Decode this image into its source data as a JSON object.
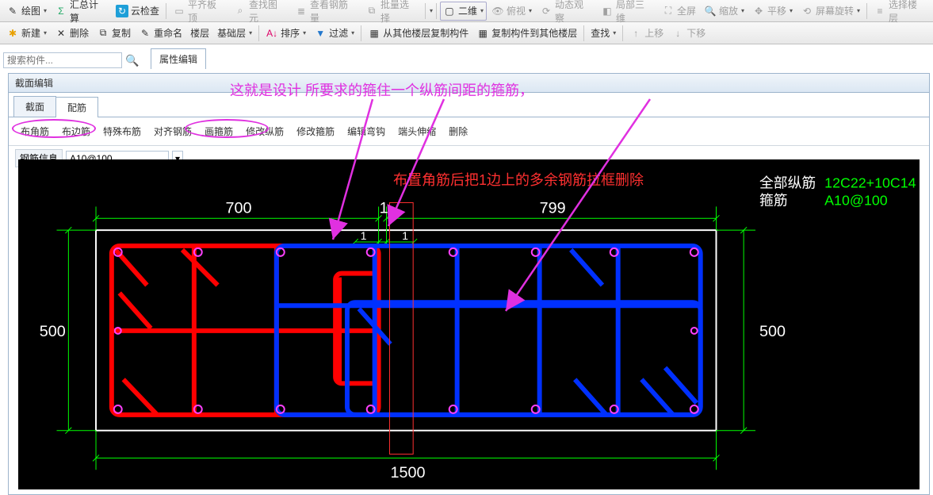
{
  "toolbar1": {
    "draw": "绘图",
    "sum": "汇总计算",
    "cloud": "云检查",
    "align_top": "平齐板顶",
    "find_elem": "查找图元",
    "check_rebar": "查看钢筋量",
    "batch_select": "批量选择",
    "view_2d": "二维",
    "look": "俯视",
    "dyn": "动态观察",
    "local3d": "局部三维",
    "full": "全屏",
    "zoom": "缩放",
    "pan": "平移",
    "rotate": "屏幕旋转",
    "select_floor": "选择楼层"
  },
  "toolbar2": {
    "new": "新建",
    "delete": "删除",
    "copy": "复制",
    "rename": "重命名",
    "floor": "楼层",
    "base": "基础层",
    "sort": "排序",
    "filter": "过滤",
    "copy_from": "从其他楼层复制构件",
    "copy_to": "复制构件到其他楼层",
    "find": "查找",
    "up": "上移",
    "down": "下移"
  },
  "search": {
    "placeholder": "搜索构件..."
  },
  "tab_attr": "属性编辑",
  "panel": {
    "title": "截面编辑"
  },
  "tabs": {
    "section": "截面",
    "rebar": "配筋"
  },
  "cmds": {
    "corner": "布角筋",
    "edge": "布边筋",
    "special": "特殊布筋",
    "align": "对齐钢筋",
    "stirrup": "画箍筋",
    "modlong": "修改纵筋",
    "modstir": "修改箍筋",
    "edithook": "编辑弯钩",
    "endext": "端头伸缩",
    "del": "删除"
  },
  "rebar_label": "钢筋信息",
  "rebar_value": "A10@100",
  "canvas": {
    "dim_top1": "700",
    "dim_top2": "1",
    "dim_top3": "799",
    "dim_bottom": "1500",
    "dim_left": "500",
    "dim_right": "500",
    "tick1": "1",
    "tick2": "1",
    "label_long": "全部纵筋",
    "label_stir": "箍筋",
    "val_long": "12C22+10C14",
    "val_stir": "A10@100"
  },
  "anno1": "这就是设计 所要求的箍住一个纵筋间距的箍筋，",
  "anno2": "布置角筋后把1边上的多余钢筋拉框删除"
}
